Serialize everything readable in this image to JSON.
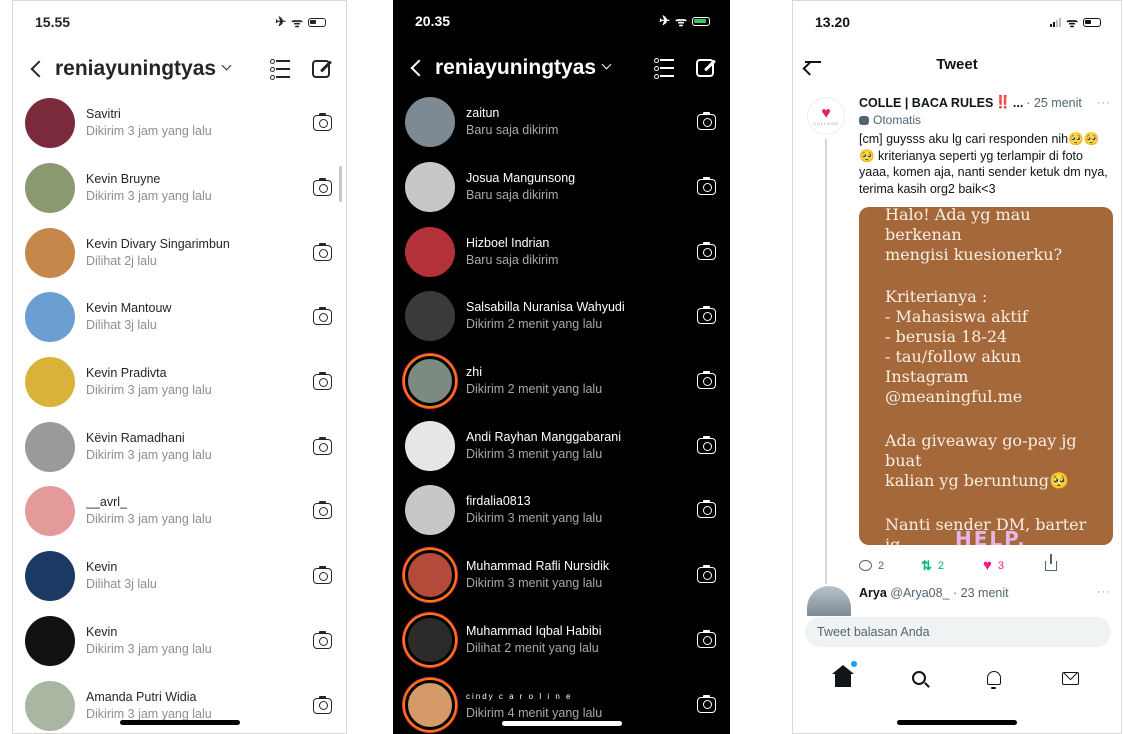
{
  "phone1": {
    "time": "15.55",
    "icons": [
      "airplane-icon",
      "wifi-icon",
      "battery-icon"
    ],
    "username": "reniayuningtyas",
    "rows": [
      {
        "name": "Savitri",
        "sub": "Dikirim 3 jam yang lalu",
        "avatar": "#7a2a3a"
      },
      {
        "name": "Kevin Bruyne",
        "sub": "Dikirim 3 jam yang lalu",
        "avatar": "#8a9a6e"
      },
      {
        "name": "Kevin Divary Singarimbun",
        "sub": "Dilihat 2j lalu",
        "avatar": "#c6884a"
      },
      {
        "name": "Kevin Mantouw",
        "sub": "Dilihat 3j lalu",
        "avatar": "#6b9fd1"
      },
      {
        "name": "Kevin Pradivta",
        "sub": "Dikirim 3 jam yang lalu",
        "avatar": "#d9b23a"
      },
      {
        "name": "Këvin Ramadhani",
        "sub": "Dikirim 3 jam yang lalu",
        "avatar": "#9a9a9a"
      },
      {
        "name": "__avrl_",
        "sub": "Dikirim 3 jam yang lalu",
        "avatar": "#e59a9a"
      },
      {
        "name": "Kevin",
        "sub": "Dilihat 3j lalu",
        "avatar": "#1b3a63"
      },
      {
        "name": "Kevin",
        "sub": "Dikirim 3 jam yang lalu",
        "avatar": "#111111"
      },
      {
        "name": "Amanda Putri Widia",
        "sub": "Dikirim 3 jam yang lalu",
        "avatar": "#a9b6a2"
      }
    ]
  },
  "phone2": {
    "time": "20.35",
    "icons": [
      "airplane-icon",
      "wifi-icon",
      "battery-charging-icon"
    ],
    "username": "reniayuningtyas",
    "rows": [
      {
        "name": "zaitun",
        "sub": "Baru saja dikirim",
        "avatar": "#7d8a93",
        "ring": false
      },
      {
        "name": "Josua Mangunsong",
        "sub": "Baru saja dikirim",
        "avatar": "#c7c7c7",
        "ring": false
      },
      {
        "name": "Hizboel Indrian",
        "sub": "Baru saja dikirim",
        "avatar": "#b3323a",
        "ring": false
      },
      {
        "name": "Salsabilla Nuranisa Wahyudi",
        "sub": "Dikirim 2 menit yang lalu",
        "avatar": "#3a3a3a",
        "ring": false
      },
      {
        "name": "zhi",
        "sub": "Dikirim 2 menit yang lalu",
        "avatar": "#7c8a80",
        "ring": true
      },
      {
        "name": "Andi Rayhan Manggabarani",
        "sub": "Dikirim 3 menit yang lalu",
        "avatar": "#e6e6e6",
        "ring": false
      },
      {
        "name": "firdalia0813",
        "sub": "Dikirim 3 menit yang lalu",
        "avatar": "#c7c7c7",
        "ring": false
      },
      {
        "name": "Muhammad Rafli Nursidik",
        "sub": "Dikirim 3 menit yang lalu",
        "avatar": "#b34a3a",
        "ring": true
      },
      {
        "name": "Muhammad Iqbal Habibi",
        "sub": "Dilihat 2 menit yang lalu",
        "avatar": "#2b2b2b",
        "ring": true
      },
      {
        "name": "cindy c a r o l i n e",
        "sub": "Dikirim 4 menit yang lalu",
        "avatar": "#d49a6a",
        "ring": true,
        "tiny": true
      }
    ]
  },
  "phone3": {
    "time": "13.20",
    "icons": [
      "signal-icon",
      "wifi-icon",
      "battery-icon"
    ],
    "title": "Tweet",
    "tweet": {
      "name": "COLLE | BACA RULES",
      "alert": "‼️",
      "ellipsis": "...",
      "time": "· 25 menit",
      "more": "···",
      "auto_label": "Otomatis",
      "logo_text": "COLLEGE",
      "text": "[cm] guysss aku lg cari responden nih🥺🥺🥺 kriterianya seperti yg terlampir di foto yaaa, komen aja, nanti sender ketuk dm nya, terima kasih org2 baik<3",
      "image_lines": {
        "g1": "Halo! Ada yg mau berkenan\nmengisi kuesionerku?",
        "g2": "Kriterianya :\n- Mahasiswa aktif\n- berusia 18-24\n- tau/follow akun Instagram\n@meaningful.me",
        "g3": "Ada giveaway go-pay jg buat\nkalian yg beruntung🥺",
        "g4": "Nanti sender DM, barter jg\nboleh bgt. Thankyou🥺👌",
        "help": "HELP."
      },
      "replies": "2",
      "retweets": "2",
      "likes": "3"
    },
    "reply": {
      "name": "Arya",
      "handle": "@Arya08_",
      "time": "· 23 menit",
      "more": "···"
    },
    "reply_placeholder": "Tweet balasan Anda"
  },
  "colors": {
    "ig_ring_orange": "#ff7a00",
    "ig_ring_pink": "#e1306c",
    "twitter_blue": "#1d9bf0",
    "retweet_green": "#00ba7c",
    "like_pink": "#f91880",
    "tweet_image_bg": "#a4683a"
  }
}
